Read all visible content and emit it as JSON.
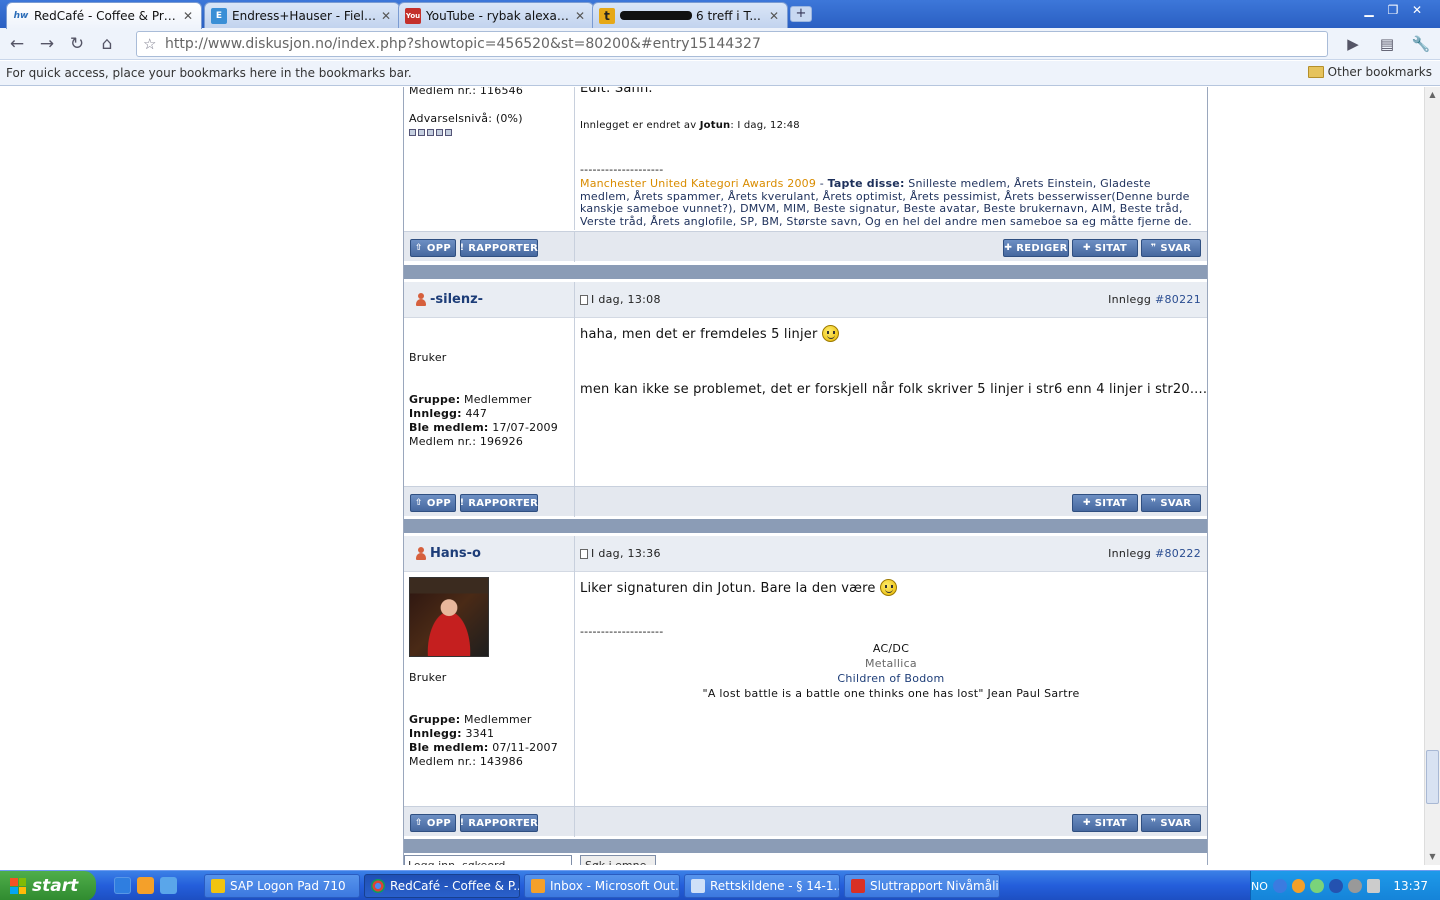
{
  "browser": {
    "tabs": [
      {
        "title": "RedCafé - Coffee & Prawn ...",
        "favicon": "hw-icon",
        "active": true
      },
      {
        "title": "Endress+Hauser - FieldCare",
        "favicon": "eh-icon",
        "active": false
      },
      {
        "title": "YouTube - rybak alexander",
        "favicon": "youtube-icon",
        "active": false
      },
      {
        "title": "6 treff i T...",
        "favicon": "t-icon",
        "active": false
      }
    ],
    "url": "http://www.diskusjon.no/index.php?showtopic=456520&st=80200&#entry15144327",
    "bookmarks_hint": "For quick access, place your bookmarks here in the bookmarks bar.",
    "other_bookmarks": "Other bookmarks"
  },
  "posts": [
    {
      "id": "post-jotun",
      "userinfo_tail": {
        "member_no": "Medlem nr.: 116546",
        "warning": "Advarselsnivå: (0%)"
      },
      "body_tail": "Edit: Sann.",
      "edited_prefix": "Innlegget er endret av",
      "edited_by": "Jotun",
      "edited_time": ": I dag, 12:48",
      "signature": {
        "dashes": "--------------------",
        "link": "Manchester United Kategori Awards 2009",
        "dash": "-",
        "bold": "Tapte disse:",
        "text": "Snilleste medlem, Årets Einstein, Gladeste medlem, Årets spammer, Årets kverulant, Årets optimist, Årets pessimist, Årets besserwisser(Denne burde kanskje sameboe vunnet?), DMVM, MIM, Beste signatur, Beste avatar, Beste brukernavn, AIM, Beste tråd, Verste tråd, Årets anglofile, SP, BM, Største savn, Og en hel del andre men sameboe sa eg måtte fjerne de."
      },
      "buttons": {
        "up": "OPP",
        "report": "RAPPORTER",
        "edit": "REDIGER",
        "quote": "SITAT",
        "reply": "SVAR"
      }
    },
    {
      "id": "post-silenz",
      "author": "-silenz-",
      "date": "I dag, 13:08",
      "post_label": "Innlegg",
      "post_no": "#80221",
      "role": "Bruker",
      "group_label": "Gruppe:",
      "group": "Medlemmer",
      "posts_label": "Innlegg:",
      "posts": "447",
      "joined_label": "Ble medlem:",
      "joined": "17/07-2009",
      "member_no": "Medlem nr.: 196926",
      "body_line1": "haha, men det er fremdeles 5 linjer",
      "body_line2": "men kan ikke se problemet, det er forskjell når folk skriver 5 linjer i str6 enn 4 linjer i str20....",
      "buttons": {
        "up": "OPP",
        "report": "RAPPORTER",
        "quote": "SITAT",
        "reply": "SVAR"
      }
    },
    {
      "id": "post-hans",
      "author": "Hans-o",
      "date": "I dag, 13:36",
      "post_label": "Innlegg",
      "post_no": "#80222",
      "role": "Bruker",
      "group_label": "Gruppe:",
      "group": "Medlemmer",
      "posts_label": "Innlegg:",
      "posts": "3341",
      "joined_label": "Ble medlem:",
      "joined": "07/11-2007",
      "member_no": "Medlem nr.: 143986",
      "body_line1": "Liker signaturen din Jotun. Bare la den være",
      "signature": {
        "dashes": "--------------------",
        "lines": [
          "AC/DC",
          "Metallica",
          "Children of Bodom",
          "\"A lost battle is a battle one thinks one has lost\" Jean Paul Sartre"
        ]
      },
      "buttons": {
        "up": "OPP",
        "report": "RAPPORTER",
        "quote": "SITAT",
        "reply": "SVAR"
      }
    }
  ],
  "footer_partial": {
    "login_input": "Logg inn, søkeord",
    "search_btn": "Søk i emne"
  },
  "taskbar": {
    "start": "start",
    "tasks": [
      {
        "label": "SAP Logon Pad 710",
        "icon": "sap-icon"
      },
      {
        "label": "RedCafé - Coffee & P...",
        "icon": "chrome-icon"
      },
      {
        "label": "Inbox - Microsoft Out...",
        "icon": "outlook-icon"
      },
      {
        "label": "Rettskildene - § 14-1...",
        "icon": "ie-doc-icon"
      },
      {
        "label": "Sluttrapport Nivåmåli...",
        "icon": "pdf-icon"
      }
    ],
    "lang": "NO",
    "clock": "13:37"
  }
}
